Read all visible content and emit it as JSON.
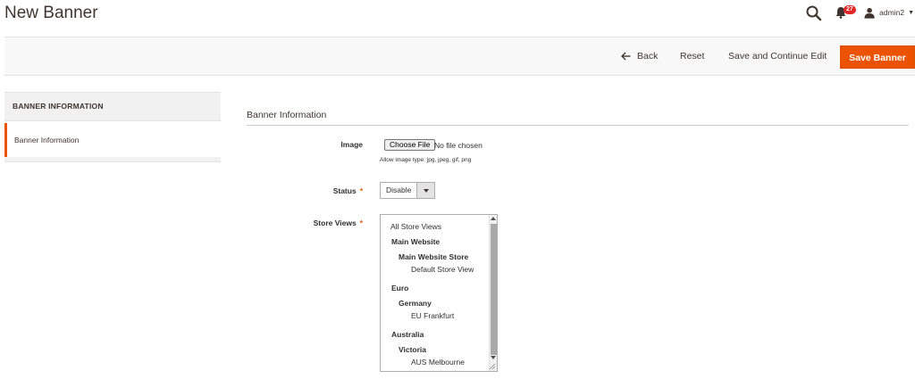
{
  "header": {
    "title": "New Banner",
    "notification_count": "27",
    "username": "admin2"
  },
  "toolbar": {
    "back_label": "Back",
    "reset_label": "Reset",
    "save_continue_label": "Save and Continue Edit",
    "save_label": "Save Banner"
  },
  "sidebar": {
    "title": "BANNER INFORMATION",
    "items": [
      {
        "label": "Banner Information"
      }
    ]
  },
  "form": {
    "section_title": "Banner Information",
    "image": {
      "label": "Image",
      "button_label": "Choose File",
      "file_status": "No file chosen",
      "hint": "Allow image type: jpg, jpeg, gif, png"
    },
    "status": {
      "label": "Status",
      "value": "Disable"
    },
    "store_views": {
      "label": "Store Views",
      "options": [
        {
          "label": "All Store Views",
          "level": 0,
          "group": false
        },
        {
          "label": "Main Website",
          "level": 0,
          "group": true
        },
        {
          "label": "Main Website Store",
          "level": 1,
          "group": true
        },
        {
          "label": "Default Store View",
          "level": 2,
          "group": false
        },
        {
          "label": "Euro",
          "level": 0,
          "group": true
        },
        {
          "label": "Germany",
          "level": 1,
          "group": true
        },
        {
          "label": "EU Frankfurt",
          "level": 2,
          "group": false
        },
        {
          "label": "Australia",
          "level": 0,
          "group": true
        },
        {
          "label": "Victoria",
          "level": 1,
          "group": true
        },
        {
          "label": "AUS Melbourne",
          "level": 2,
          "group": false
        }
      ]
    }
  },
  "colors": {
    "accent": "#eb5202",
    "badge": "#e22626",
    "text": "#41362f"
  }
}
